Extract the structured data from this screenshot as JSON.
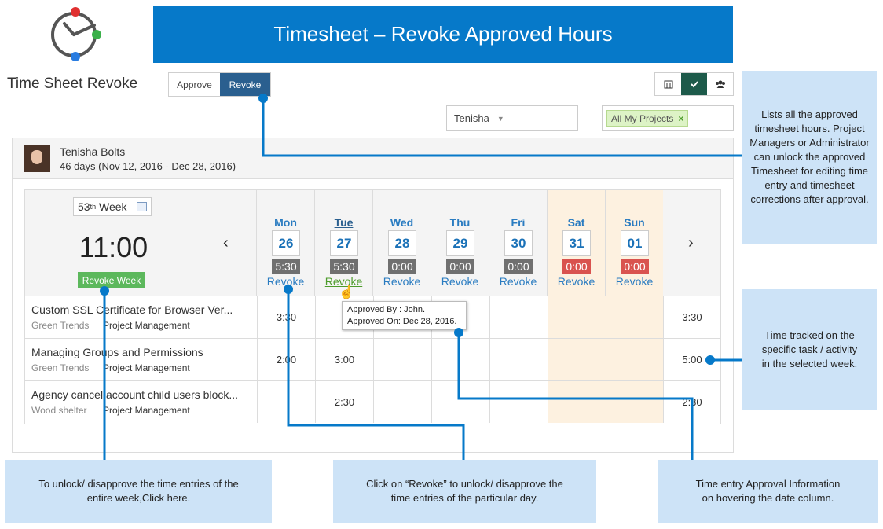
{
  "banner": {
    "title": "Timesheet – Revoke Approved Hours"
  },
  "app": {
    "title": "Time Sheet Revoke"
  },
  "mode": {
    "approve": "Approve",
    "revoke": "Revoke"
  },
  "filters": {
    "user": "Tenisha",
    "project_tag": "All My Projects",
    "project_tag_remove": "×"
  },
  "user": {
    "name": "Tenisha Bolts",
    "range": "46 days (Nov 12, 2016 - Dec 28, 2016)"
  },
  "week": {
    "label_num": "53",
    "label_sup": "th",
    "label_word": "Week",
    "total": "11:00",
    "revoke_week": "Revoke Week",
    "prev": "‹",
    "next": "›"
  },
  "days": [
    {
      "name": "Mon",
      "date": "26",
      "hours": "5:30",
      "action": "Revoke",
      "weekend": false
    },
    {
      "name": "Tue",
      "date": "27",
      "hours": "5:30",
      "action": "Revoke",
      "weekend": false
    },
    {
      "name": "Wed",
      "date": "28",
      "hours": "0:00",
      "action": "Revoke",
      "weekend": false
    },
    {
      "name": "Thu",
      "date": "29",
      "hours": "0:00",
      "action": "Revoke",
      "weekend": false
    },
    {
      "name": "Fri",
      "date": "30",
      "hours": "0:00",
      "action": "Revoke",
      "weekend": false
    },
    {
      "name": "Sat",
      "date": "31",
      "hours": "0:00",
      "action": "Revoke",
      "weekend": true
    },
    {
      "name": "Sun",
      "date": "01",
      "hours": "0:00",
      "action": "Revoke",
      "weekend": true
    }
  ],
  "rows": [
    {
      "title": "Custom SSL Certificate for Browser Ver...",
      "client": "Green Trends",
      "project": "Project Management",
      "mon": "3:30",
      "tue": "",
      "total": "3:30"
    },
    {
      "title": "Managing Groups and Permissions",
      "client": "Green Trends",
      "project": "Project Management",
      "mon": "2:00",
      "tue": "3:00",
      "total": "5:00"
    },
    {
      "title": "Agency cancel account child users block...",
      "client": "Wood shelter",
      "project": "Project Management",
      "mon": "",
      "tue": "2:30",
      "total": "2:30"
    }
  ],
  "tooltip": {
    "line1": "Approved By : John.",
    "line2": "Approved On: Dec 28, 2016."
  },
  "notes": {
    "n1": "Lists all the approved timesheet hours. Project Managers or Administrator can unlock the approved Timesheet for editing time entry and timesheet corrections after approval.",
    "n2": "Time tracked on the specific task / activity in the selected week.",
    "n3": "To unlock/ disapprove the time entries of the entire week,Click here.",
    "n4": "Click on “Revoke” to unlock/ disapprove the time entries of the particular day.",
    "n5": "Time entry Approval Information on hovering the date column."
  },
  "colors": {
    "accent": "#0679c9",
    "callout": "#cde3f7",
    "approve_green": "#5cb85c",
    "weekend": "#fdf1e0"
  }
}
